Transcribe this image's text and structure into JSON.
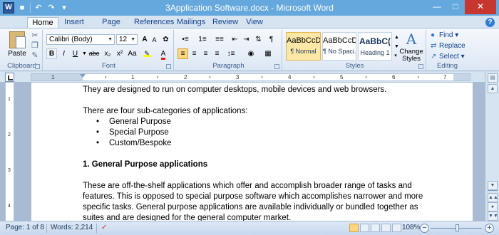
{
  "window": {
    "title": "3Application Software.docx - Microsoft Word",
    "app_icon": "W",
    "controls": [
      "minimize-icon",
      "maximize-icon",
      "close-icon"
    ]
  },
  "quick_access": [
    "save-icon",
    "undo-icon",
    "redo-icon",
    "customize-icon"
  ],
  "tabs": [
    {
      "label": "Home"
    },
    {
      "label": "Insert"
    },
    {
      "label": "Page Layout"
    },
    {
      "label": "References"
    },
    {
      "label": "Mailings"
    },
    {
      "label": "Review"
    },
    {
      "label": "View"
    }
  ],
  "active_tab": "Home",
  "ribbon": {
    "clipboard": {
      "label": "Clipboard",
      "paste_label": "Paste"
    },
    "font": {
      "label": "Font",
      "font_name": "Calibri (Body)",
      "font_size": "12",
      "grow": "A",
      "shrink": "A",
      "bold": "B",
      "italic": "I",
      "underline": "U",
      "strikethrough": "abc",
      "subscript": "x₂",
      "superscript": "x²",
      "change_case": "Aa",
      "font_color": "A",
      "highlight_color": "#ffff00",
      "text_color": "#e02020"
    },
    "paragraph": {
      "label": "Paragraph",
      "show_marks": "¶"
    },
    "styles": {
      "label": "Styles",
      "items": [
        {
          "sample": "AaBbCcD",
          "name": "¶ Normal"
        },
        {
          "sample": "AaBbCcD",
          "name": "¶ No Spaci..."
        },
        {
          "sample": "AaBbC(",
          "name": "Heading 1"
        }
      ],
      "change_styles": "Change Styles"
    },
    "editing": {
      "label": "Editing",
      "find": "Find",
      "replace": "Replace",
      "select": "Select"
    }
  },
  "ruler": {
    "numbers": [
      "1",
      "1",
      "2",
      "3",
      "4",
      "5",
      "6",
      "7"
    ],
    "vnumbers": [
      "1",
      "2",
      "3",
      "4"
    ]
  },
  "document": {
    "line1": "They are designed to  run on computer desktops, mobile devices and web browsers.",
    "line2": "There are four sub-categories of applications:",
    "bullets": [
      "General Purpose",
      "Special Purpose",
      "Custom/Bespoke"
    ],
    "heading": "1.  General Purpose applications",
    "para": [
      "These are off-the-shelf  applications which offer and accomplish broader range of tasks and",
      "features. This is opposed to special purpose software which accomplishes narrower and more",
      "specific tasks. General purpose applications are available individually or bundled together as",
      "suites and are designed  for the general computer market."
    ]
  },
  "status": {
    "page": "Page: 1 of 8",
    "words": "Words: 2,214",
    "zoom": "108%",
    "zoom_level_percent": 108
  }
}
